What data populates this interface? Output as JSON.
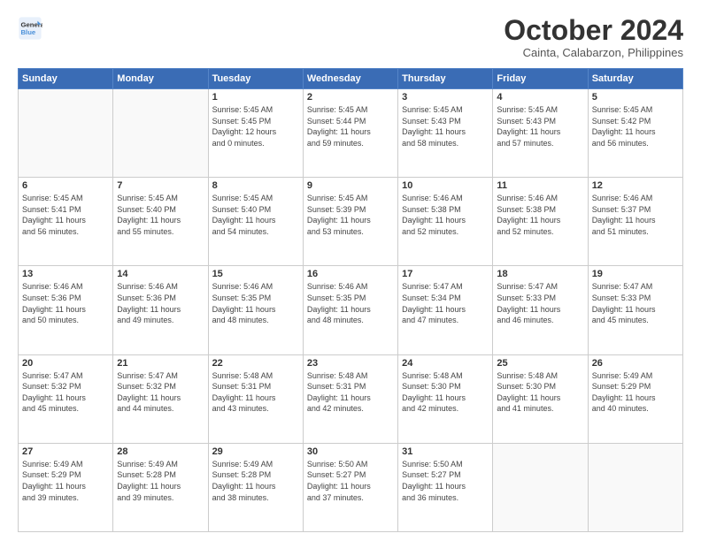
{
  "logo": {
    "line1": "General",
    "line2": "Blue"
  },
  "title": "October 2024",
  "subtitle": "Cainta, Calabarzon, Philippines",
  "days_header": [
    "Sunday",
    "Monday",
    "Tuesday",
    "Wednesday",
    "Thursday",
    "Friday",
    "Saturday"
  ],
  "weeks": [
    [
      {
        "day": "",
        "info": ""
      },
      {
        "day": "",
        "info": ""
      },
      {
        "day": "1",
        "info": "Sunrise: 5:45 AM\nSunset: 5:45 PM\nDaylight: 12 hours\nand 0 minutes."
      },
      {
        "day": "2",
        "info": "Sunrise: 5:45 AM\nSunset: 5:44 PM\nDaylight: 11 hours\nand 59 minutes."
      },
      {
        "day": "3",
        "info": "Sunrise: 5:45 AM\nSunset: 5:43 PM\nDaylight: 11 hours\nand 58 minutes."
      },
      {
        "day": "4",
        "info": "Sunrise: 5:45 AM\nSunset: 5:43 PM\nDaylight: 11 hours\nand 57 minutes."
      },
      {
        "day": "5",
        "info": "Sunrise: 5:45 AM\nSunset: 5:42 PM\nDaylight: 11 hours\nand 56 minutes."
      }
    ],
    [
      {
        "day": "6",
        "info": "Sunrise: 5:45 AM\nSunset: 5:41 PM\nDaylight: 11 hours\nand 56 minutes."
      },
      {
        "day": "7",
        "info": "Sunrise: 5:45 AM\nSunset: 5:40 PM\nDaylight: 11 hours\nand 55 minutes."
      },
      {
        "day": "8",
        "info": "Sunrise: 5:45 AM\nSunset: 5:40 PM\nDaylight: 11 hours\nand 54 minutes."
      },
      {
        "day": "9",
        "info": "Sunrise: 5:45 AM\nSunset: 5:39 PM\nDaylight: 11 hours\nand 53 minutes."
      },
      {
        "day": "10",
        "info": "Sunrise: 5:46 AM\nSunset: 5:38 PM\nDaylight: 11 hours\nand 52 minutes."
      },
      {
        "day": "11",
        "info": "Sunrise: 5:46 AM\nSunset: 5:38 PM\nDaylight: 11 hours\nand 52 minutes."
      },
      {
        "day": "12",
        "info": "Sunrise: 5:46 AM\nSunset: 5:37 PM\nDaylight: 11 hours\nand 51 minutes."
      }
    ],
    [
      {
        "day": "13",
        "info": "Sunrise: 5:46 AM\nSunset: 5:36 PM\nDaylight: 11 hours\nand 50 minutes."
      },
      {
        "day": "14",
        "info": "Sunrise: 5:46 AM\nSunset: 5:36 PM\nDaylight: 11 hours\nand 49 minutes."
      },
      {
        "day": "15",
        "info": "Sunrise: 5:46 AM\nSunset: 5:35 PM\nDaylight: 11 hours\nand 48 minutes."
      },
      {
        "day": "16",
        "info": "Sunrise: 5:46 AM\nSunset: 5:35 PM\nDaylight: 11 hours\nand 48 minutes."
      },
      {
        "day": "17",
        "info": "Sunrise: 5:47 AM\nSunset: 5:34 PM\nDaylight: 11 hours\nand 47 minutes."
      },
      {
        "day": "18",
        "info": "Sunrise: 5:47 AM\nSunset: 5:33 PM\nDaylight: 11 hours\nand 46 minutes."
      },
      {
        "day": "19",
        "info": "Sunrise: 5:47 AM\nSunset: 5:33 PM\nDaylight: 11 hours\nand 45 minutes."
      }
    ],
    [
      {
        "day": "20",
        "info": "Sunrise: 5:47 AM\nSunset: 5:32 PM\nDaylight: 11 hours\nand 45 minutes."
      },
      {
        "day": "21",
        "info": "Sunrise: 5:47 AM\nSunset: 5:32 PM\nDaylight: 11 hours\nand 44 minutes."
      },
      {
        "day": "22",
        "info": "Sunrise: 5:48 AM\nSunset: 5:31 PM\nDaylight: 11 hours\nand 43 minutes."
      },
      {
        "day": "23",
        "info": "Sunrise: 5:48 AM\nSunset: 5:31 PM\nDaylight: 11 hours\nand 42 minutes."
      },
      {
        "day": "24",
        "info": "Sunrise: 5:48 AM\nSunset: 5:30 PM\nDaylight: 11 hours\nand 42 minutes."
      },
      {
        "day": "25",
        "info": "Sunrise: 5:48 AM\nSunset: 5:30 PM\nDaylight: 11 hours\nand 41 minutes."
      },
      {
        "day": "26",
        "info": "Sunrise: 5:49 AM\nSunset: 5:29 PM\nDaylight: 11 hours\nand 40 minutes."
      }
    ],
    [
      {
        "day": "27",
        "info": "Sunrise: 5:49 AM\nSunset: 5:29 PM\nDaylight: 11 hours\nand 39 minutes."
      },
      {
        "day": "28",
        "info": "Sunrise: 5:49 AM\nSunset: 5:28 PM\nDaylight: 11 hours\nand 39 minutes."
      },
      {
        "day": "29",
        "info": "Sunrise: 5:49 AM\nSunset: 5:28 PM\nDaylight: 11 hours\nand 38 minutes."
      },
      {
        "day": "30",
        "info": "Sunrise: 5:50 AM\nSunset: 5:27 PM\nDaylight: 11 hours\nand 37 minutes."
      },
      {
        "day": "31",
        "info": "Sunrise: 5:50 AM\nSunset: 5:27 PM\nDaylight: 11 hours\nand 36 minutes."
      },
      {
        "day": "",
        "info": ""
      },
      {
        "day": "",
        "info": ""
      }
    ]
  ]
}
